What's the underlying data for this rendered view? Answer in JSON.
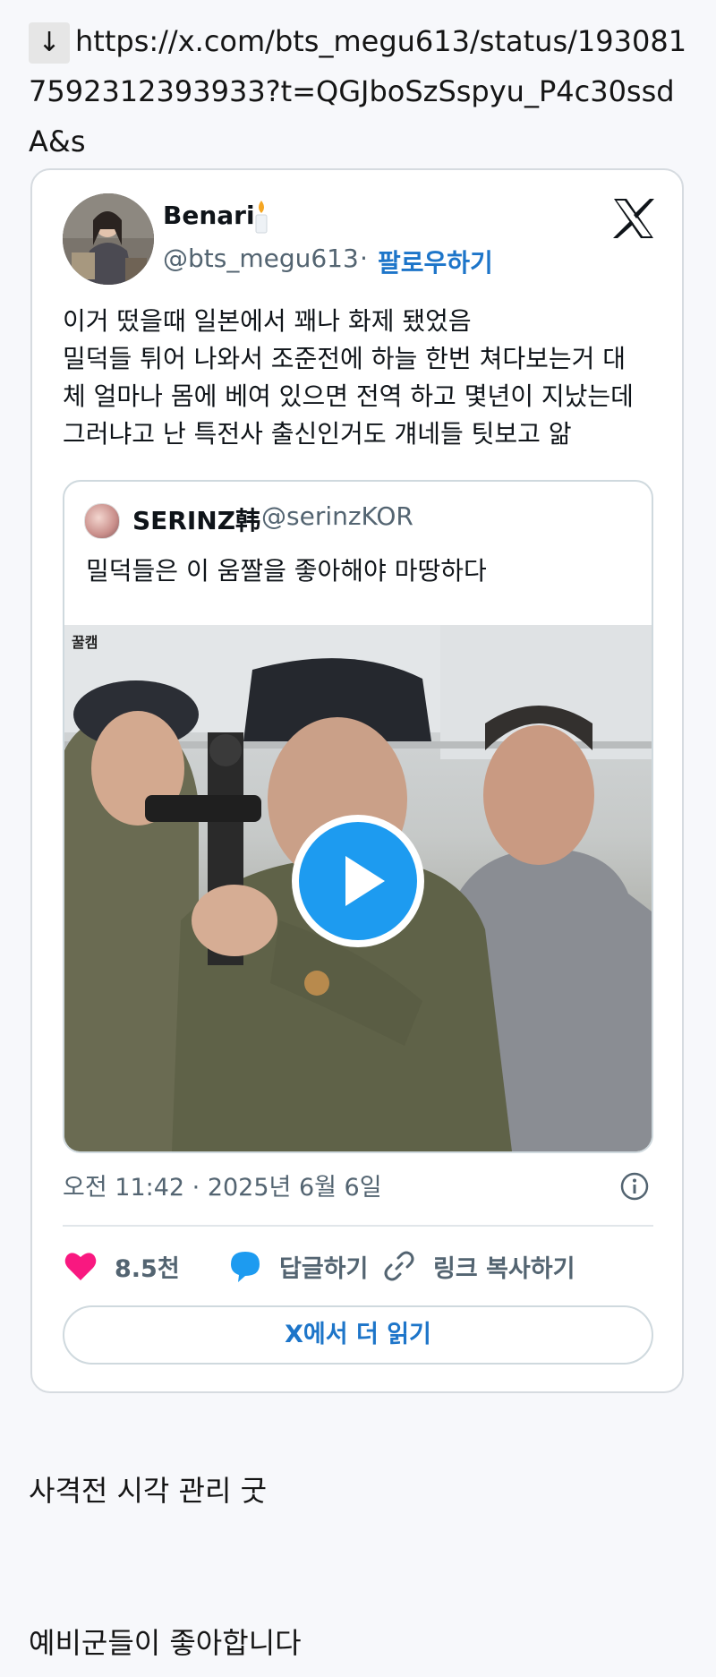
{
  "post": {
    "arrow_symbol": "↓",
    "link_url": "https://x.com/bts_megu613/status/1930817592312393933?t=QGJboSzSspyu_P4c30ssdA&s",
    "comments": [
      "사격전 시각 관리 굿",
      "예비군들이 좋아합니다"
    ]
  },
  "embed": {
    "author_name": "Benari",
    "author_handle": "@bts_megu613",
    "separator": "·",
    "follow_label": "팔로우하기",
    "tweet_lines": [
      "이거 떴을때 일본에서 꽤나 화제 됐었음",
      "밀덕들 튀어 나와서 조준전에 하늘 한번 쳐다보는거 대",
      "체 얼마나 몸에 베여 있으면 전역 하고 몇년이 지났는데",
      "그러냐고 난 특전사 출신인거도 걔네들 팃보고 앎"
    ],
    "quote": {
      "name": "SERINZ韩",
      "handle": "@serinzKOR",
      "text": "밀덕들은 이 움짤을 좋아해야 마땅하다",
      "media_watermark": "꿀캠"
    },
    "timestamp": "오전 11:42 · 2025년 6월 6일",
    "actions": {
      "likes_count": "8.5천",
      "reply_label": "답글하기",
      "copy_link_label": "링크 복사하기"
    },
    "read_more_label": "X에서 더 읽기"
  },
  "colors": {
    "link_blue": "#1d75c9",
    "play_blue": "#1d9bf0",
    "like_pink": "#f91880",
    "muted_text": "#536471"
  },
  "icons": [
    "download-arrow-icon",
    "candle-icon",
    "x-logo-icon",
    "play-icon",
    "info-icon",
    "heart-icon",
    "reply-bubble-icon",
    "link-icon"
  ]
}
